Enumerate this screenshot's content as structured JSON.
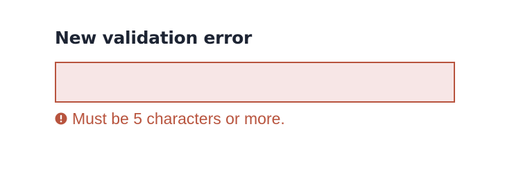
{
  "field": {
    "label": "New validation error",
    "value": "",
    "placeholder": "",
    "error_message": "Must be 5 characters or more.",
    "error_icon": "exclamation-circle-icon"
  },
  "colors": {
    "label": "#1d2433",
    "error": "#b8543e",
    "input_background": "#f7e6e6"
  }
}
